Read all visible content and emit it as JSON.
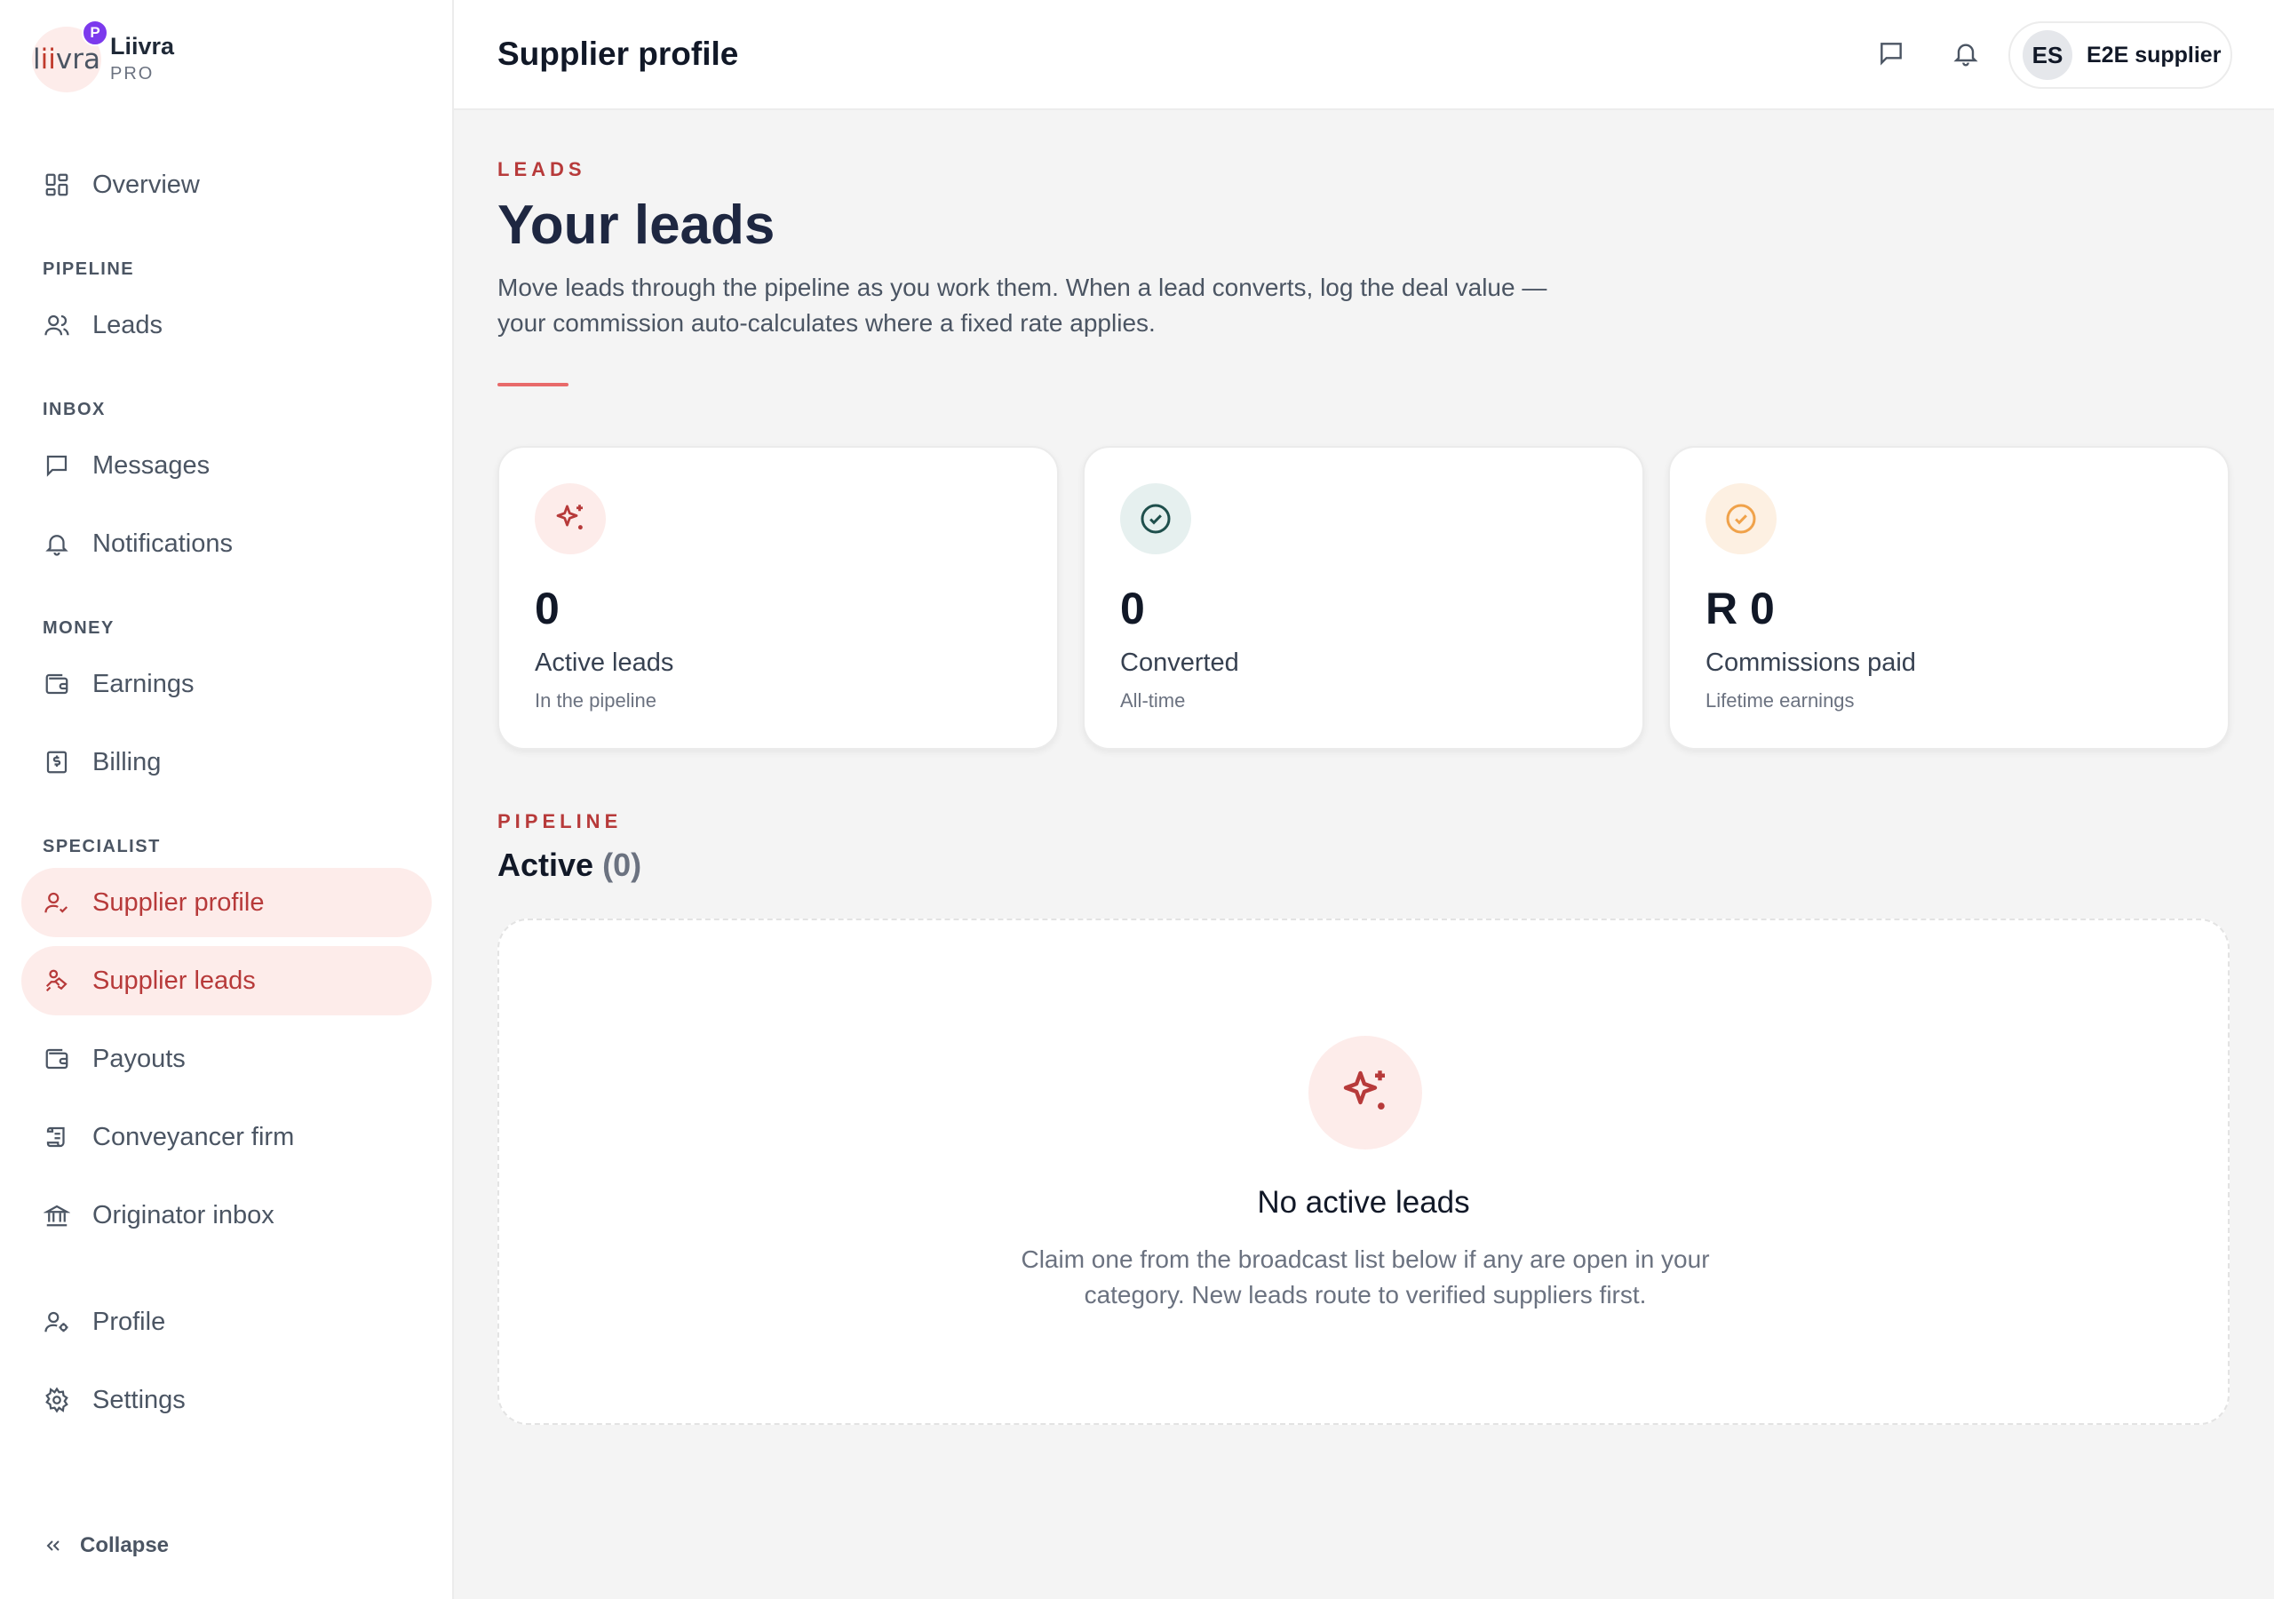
{
  "brand": {
    "logo_text": "liivra",
    "badge": "P",
    "name": "Liivra",
    "tier": "PRO"
  },
  "sidebar": {
    "sections": {
      "pipeline": "PIPELINE",
      "inbox": "INBOX",
      "money": "MONEY",
      "specialist": "SPECIALIST"
    },
    "items": [
      {
        "label": "Overview",
        "icon": "grid-icon"
      },
      {
        "label": "Leads",
        "icon": "users-icon"
      },
      {
        "label": "Messages",
        "icon": "chat-icon"
      },
      {
        "label": "Notifications",
        "icon": "bell-icon"
      },
      {
        "label": "Earnings",
        "icon": "wallet-icon"
      },
      {
        "label": "Billing",
        "icon": "receipt-icon"
      },
      {
        "label": "Supplier profile",
        "icon": "user-check-icon",
        "active": true
      },
      {
        "label": "Supplier leads",
        "icon": "handshake-icon",
        "active": true
      },
      {
        "label": "Payouts",
        "icon": "wallet-icon"
      },
      {
        "label": "Conveyancer firm",
        "icon": "scroll-icon"
      },
      {
        "label": "Originator inbox",
        "icon": "bank-icon"
      },
      {
        "label": "Profile",
        "icon": "user-cog-icon"
      },
      {
        "label": "Settings",
        "icon": "gear-icon"
      }
    ],
    "collapse_label": "Collapse"
  },
  "header": {
    "title": "Supplier profile",
    "user": {
      "initials": "ES",
      "name": "E2E supplier"
    }
  },
  "hero": {
    "eyebrow": "LEADS",
    "title": "Your leads",
    "description": "Move leads through the pipeline as you work them. When a lead converts, log the deal value — your commission auto-calculates where a fixed rate applies."
  },
  "stats": [
    {
      "value": "0",
      "label": "Active leads",
      "sub": "In the pipeline",
      "icon": "sparkles-icon",
      "icon_bg": "#fdecea",
      "icon_color": "#b73a3a"
    },
    {
      "value": "0",
      "label": "Converted",
      "sub": "All-time",
      "icon": "check-circle-icon",
      "icon_bg": "#e6f0ef",
      "icon_color": "#1f4f4c"
    },
    {
      "value": "R 0",
      "label": "Commissions paid",
      "sub": "Lifetime earnings",
      "icon": "check-circle-icon",
      "icon_bg": "#fdf0e2",
      "icon_color": "#f0a24a"
    }
  ],
  "pipeline": {
    "eyebrow": "PIPELINE",
    "title": "Active",
    "count": "(0)",
    "empty": {
      "icon": "sparkles-icon",
      "title": "No active leads",
      "description": "Claim one from the broadcast list below if any are open in your category. New leads route to verified suppliers first."
    }
  },
  "colors": {
    "accent": "#b73a3a",
    "accent_soft": "#fdecea",
    "badge": "#7c3aed"
  }
}
